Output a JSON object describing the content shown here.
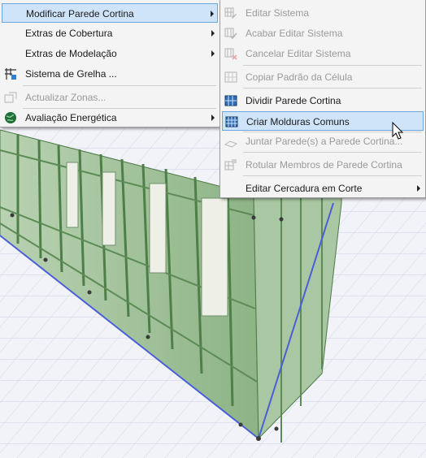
{
  "main_menu": {
    "items": [
      {
        "label": "Modificar Parede Cortina",
        "icon": "none",
        "submenu": true,
        "highlighted": true,
        "disabled": false
      },
      {
        "label": "Extras de Cobertura",
        "icon": "none",
        "submenu": true,
        "highlighted": false,
        "disabled": false
      },
      {
        "label": "Extras de Modelação",
        "icon": "none",
        "submenu": true,
        "highlighted": false,
        "disabled": false
      },
      {
        "label": "Sistema de Grelha ...",
        "icon": "grid-system-icon",
        "submenu": false,
        "highlighted": false,
        "disabled": false
      },
      {
        "label": "Actualizar Zonas...",
        "icon": "update-zones-icon",
        "submenu": false,
        "highlighted": false,
        "disabled": true
      },
      {
        "label": "Avaliação Energética",
        "icon": "energy-globe-icon",
        "submenu": true,
        "highlighted": false,
        "disabled": false
      }
    ]
  },
  "sub_menu": {
    "items": [
      {
        "label": "Editar Sistema",
        "icon": "edit-system-icon",
        "disabled": true,
        "highlighted": false
      },
      {
        "label": "Acabar Editar Sistema",
        "icon": "finish-edit-icon",
        "disabled": true,
        "highlighted": false
      },
      {
        "label": "Cancelar Editar Sistema",
        "icon": "cancel-edit-icon",
        "disabled": true,
        "highlighted": false
      },
      {
        "label": "Copiar Padrão da Célula",
        "icon": "copy-pattern-icon",
        "disabled": true,
        "highlighted": false
      },
      {
        "label": "Dividir Parede Cortina",
        "icon": "divide-wall-icon",
        "disabled": false,
        "highlighted": false
      },
      {
        "label": "Criar Molduras Comuns",
        "icon": "common-frames-icon",
        "disabled": false,
        "highlighted": true
      },
      {
        "label": "Juntar Parede(s) a Parede Cortina...",
        "icon": "join-walls-icon",
        "disabled": true,
        "highlighted": false
      },
      {
        "label": "Rotular Membros de Parede Cortina",
        "icon": "label-members-icon",
        "disabled": true,
        "highlighted": false
      },
      {
        "label": "Editar Cercadura em Corte",
        "icon": "none",
        "disabled": false,
        "highlighted": false,
        "submenu": true
      }
    ]
  },
  "colors": {
    "highlight_bg": "#cfe4f9",
    "highlight_border": "#6aa7e0",
    "wall_green": "#8fb489",
    "floor": "#f1f3f8"
  }
}
